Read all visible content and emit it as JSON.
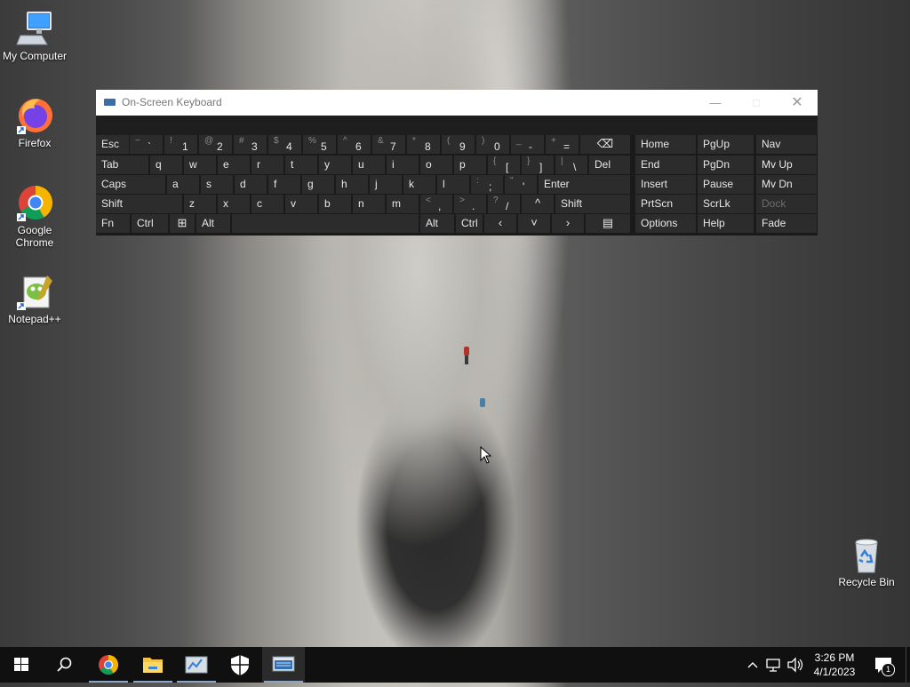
{
  "desktop": {
    "icons": [
      {
        "label": "My Computer"
      },
      {
        "label": "Firefox"
      },
      {
        "label": "Google Chrome"
      },
      {
        "label": "Notepad++"
      },
      {
        "label": "Recycle Bin"
      }
    ]
  },
  "osk": {
    "title": "On-Screen Keyboard",
    "rows": {
      "r1": [
        {
          "label": "Esc"
        },
        {
          "sec": "~",
          "pri": "`"
        },
        {
          "sec": "!",
          "pri": "1"
        },
        {
          "sec": "@",
          "pri": "2"
        },
        {
          "sec": "#",
          "pri": "3"
        },
        {
          "sec": "$",
          "pri": "4"
        },
        {
          "sec": "%",
          "pri": "5"
        },
        {
          "sec": "^",
          "pri": "6"
        },
        {
          "sec": "&",
          "pri": "7"
        },
        {
          "sec": "*",
          "pri": "8"
        },
        {
          "sec": "(",
          "pri": "9"
        },
        {
          "sec": ")",
          "pri": "0"
        },
        {
          "sec": "_",
          "pri": "-"
        },
        {
          "sec": "+",
          "pri": "="
        },
        {
          "glyph": "⌫"
        }
      ],
      "r2": [
        {
          "label": "Tab"
        },
        {
          "label": "q"
        },
        {
          "label": "w"
        },
        {
          "label": "e"
        },
        {
          "label": "r"
        },
        {
          "label": "t"
        },
        {
          "label": "y"
        },
        {
          "label": "u"
        },
        {
          "label": "i"
        },
        {
          "label": "o"
        },
        {
          "label": "p"
        },
        {
          "sec": "{",
          "pri": "["
        },
        {
          "sec": "}",
          "pri": "]"
        },
        {
          "sec": "|",
          "pri": "\\"
        },
        {
          "label": "Del"
        }
      ],
      "r3": [
        {
          "label": "Caps"
        },
        {
          "label": "a"
        },
        {
          "label": "s"
        },
        {
          "label": "d"
        },
        {
          "label": "f"
        },
        {
          "label": "g"
        },
        {
          "label": "h"
        },
        {
          "label": "j"
        },
        {
          "label": "k"
        },
        {
          "label": "l"
        },
        {
          "sec": ":",
          "pri": ";"
        },
        {
          "sec": "\"",
          "pri": "'"
        },
        {
          "label": "Enter"
        }
      ],
      "r4": [
        {
          "label": "Shift"
        },
        {
          "label": "z"
        },
        {
          "label": "x"
        },
        {
          "label": "c"
        },
        {
          "label": "v"
        },
        {
          "label": "b"
        },
        {
          "label": "n"
        },
        {
          "label": "m"
        },
        {
          "sec": "<",
          "pri": ","
        },
        {
          "sec": ">",
          "pri": "."
        },
        {
          "sec": "?",
          "pri": "/"
        },
        {
          "glyph": "^"
        },
        {
          "label": "Shift"
        }
      ],
      "r5": [
        {
          "label": "Fn"
        },
        {
          "label": "Ctrl"
        },
        {
          "glyph": "⊞"
        },
        {
          "label": "Alt"
        },
        {
          "label": ""
        },
        {
          "label": "Alt"
        },
        {
          "label": "Ctrl"
        },
        {
          "glyph": "‹"
        },
        {
          "glyph": "˅"
        },
        {
          "glyph": "›"
        },
        {
          "glyph": "▤"
        }
      ]
    },
    "nav": [
      [
        "Home",
        "PgUp",
        "Nav"
      ],
      [
        "End",
        "PgDn",
        "Mv Up"
      ],
      [
        "Insert",
        "Pause",
        "Mv Dn"
      ],
      [
        "PrtScn",
        "ScrLk",
        "Dock"
      ],
      [
        "Options",
        "Help",
        "Fade"
      ]
    ]
  },
  "taskbar": {
    "time": "3:26 PM",
    "date": "4/1/2023",
    "notification_count": "1"
  }
}
